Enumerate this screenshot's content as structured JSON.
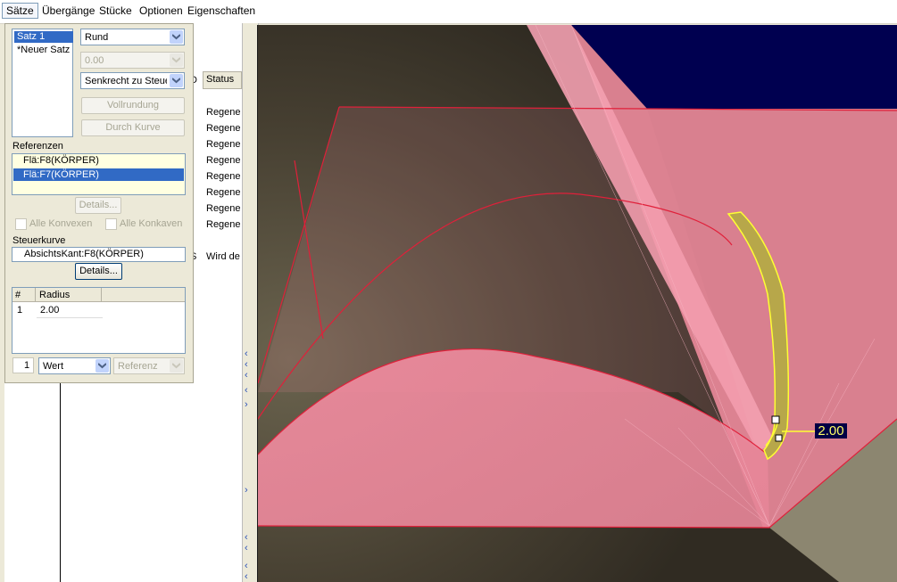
{
  "menu": {
    "items": [
      "Sätze",
      "Übergänge",
      "Stücke",
      "Optionen",
      "Eigenschaften"
    ]
  },
  "tree": {
    "header_status": "Status",
    "header_id": "D",
    "statuses": [
      "Regene",
      "Regene",
      "Regene",
      "Regene",
      "Regene",
      "Regene",
      "Regene",
      "Regene",
      "Wird de"
    ],
    "extra_char": "S"
  },
  "panel": {
    "sets": [
      "Satz 1",
      "*Neuer Satz"
    ],
    "shape_dropdown": "Rund",
    "value_dropdown": "0.00",
    "method_dropdown": "Senkrecht zu Steuerkurve",
    "btn_vollrundung": "Vollrundung",
    "btn_durch_kurve": "Durch Kurve",
    "referenzen_label": "Referenzen",
    "references": [
      "Flä:F8(KÖRPER)",
      "Flä:F7(KÖRPER)"
    ],
    "details_btn_1": "Details...",
    "alle_konvexen": "Alle Konvexen",
    "alle_konkaven": "Alle Konkaven",
    "steuerkurve_label": "Steuerkurve",
    "steuerkurve_value": "AbsichtsKant:F8(KÖRPER)",
    "details_btn_2": "Details...",
    "radius_table": {
      "columns": [
        "#",
        "Radius"
      ],
      "rows": [
        [
          "1",
          "2.00"
        ]
      ]
    },
    "bottom_index": "1",
    "wert_dropdown": "Wert",
    "referenz_dropdown": "Referenz"
  },
  "viewport": {
    "dimension_label": "2.00",
    "colors": {
      "background_dark": "#3e3a2e",
      "surface_pink": "#f08c9e",
      "edge_red": "#e0203a",
      "highlight_yellow": "#ffff33",
      "sky_navy": "#000050",
      "khaki": "#8c8670"
    }
  }
}
